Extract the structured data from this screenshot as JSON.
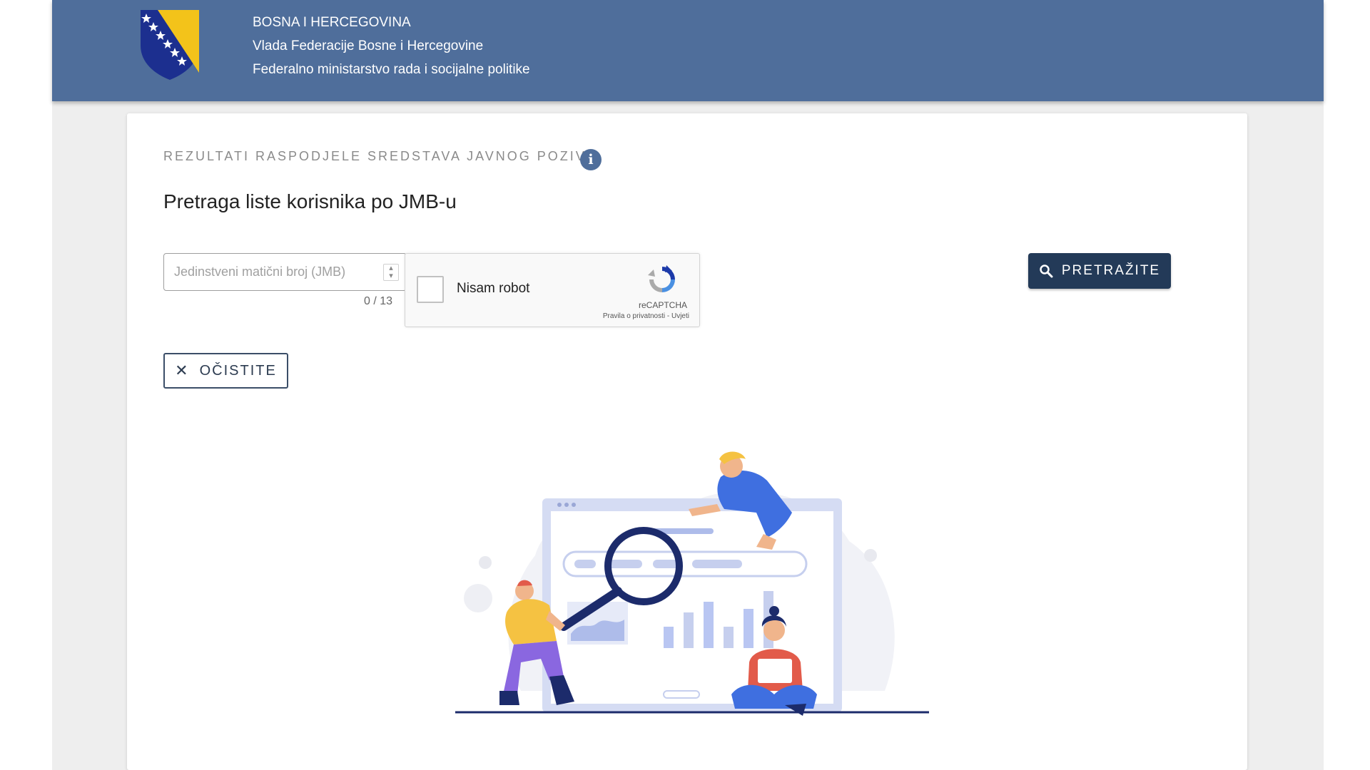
{
  "header": {
    "line1": "BOSNA I HERCEGOVINA",
    "line2": "Vlada Federacije Bosne i Hercegovine",
    "line3": "Federalno ministarstvo rada i socijalne politike",
    "logo_icon": "coat-of-arms-icon"
  },
  "card": {
    "overline": "REZULTATI RASPODJELE SREDSTAVA JAVNOG POZIVA",
    "info_icon": "info-icon",
    "title": "Pretraga liste korisnika po JMB-u"
  },
  "jmb": {
    "placeholder": "Jedinstveni matični broj (JMB)",
    "value": "",
    "counter": "0 / 13"
  },
  "recaptcha": {
    "label": "Nisam robot",
    "brand": "reCAPTCHA",
    "links": "Pravila o privatnosti - Uvjeti"
  },
  "buttons": {
    "search": "PRETRAŽITE",
    "clear": "OČISTITE"
  },
  "colors": {
    "header_bg": "#4f6e9b",
    "primary": "#233a58",
    "accent_blue": "#3f6fe0",
    "accent_yellow": "#f5c242"
  }
}
